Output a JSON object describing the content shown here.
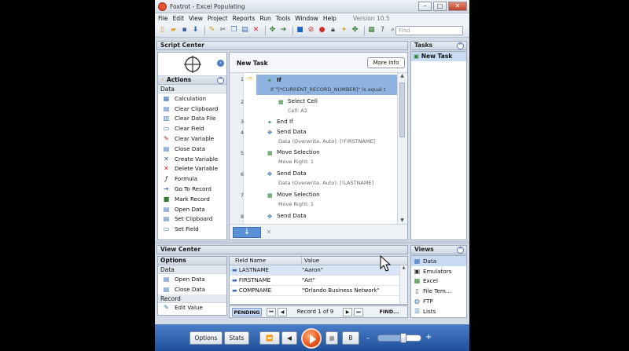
{
  "window": {
    "title": "Foxtrot - Excel Populating"
  },
  "menu": {
    "items": [
      "File",
      "Edit",
      "View",
      "Project",
      "Reports",
      "Run",
      "Tools",
      "Window",
      "Help"
    ],
    "version": "Version 10.5"
  },
  "search": {
    "placeholder": "Find"
  },
  "script_center": {
    "header": "Script Center",
    "actions_header": "Actions",
    "category_data": "Data",
    "actions": [
      "Calculation",
      "Clear Clipboard",
      "Clear Data File",
      "Clear Field",
      "Clear Variable",
      "Close Data",
      "Create Variable",
      "Delete Variable",
      "Formula",
      "Go To Record",
      "Mark Record",
      "Open Data",
      "Set Clipboard",
      "Set Field"
    ],
    "task_title": "New Task",
    "more_info": "More Info",
    "steps": [
      {
        "num": "1",
        "title": "If",
        "sub": "If \"[*CURRENT_RECORD_NUMBER]\" is equal t"
      },
      {
        "num": "2",
        "title": "Select Cell",
        "sub": "Cell:  A2"
      },
      {
        "num": "3",
        "title": "End If",
        "sub": ""
      },
      {
        "num": "4",
        "title": "Send Data",
        "sub": "Data (Overwrite, Auto):  [!FIRSTNAME]"
      },
      {
        "num": "5",
        "title": "Move Selection",
        "sub": "Move Right:  1"
      },
      {
        "num": "6",
        "title": "Send Data",
        "sub": "Data (Overwrite, Auto):  [!LASTNAME]"
      },
      {
        "num": "7",
        "title": "Move Selection",
        "sub": "Move Right:  1"
      },
      {
        "num": "8",
        "title": "Send Data",
        "sub": ""
      }
    ]
  },
  "tasks": {
    "header": "Tasks",
    "items": [
      "New Task"
    ]
  },
  "view_center": {
    "header": "View Center",
    "options_header": "Options",
    "category_data": "Data",
    "data_items": [
      "Open Data",
      "Close Data"
    ],
    "category_record": "Record",
    "record_items": [
      "Edit Value"
    ],
    "columns": [
      "Field Name",
      "Value"
    ],
    "rows": [
      {
        "field": "LASTNAME",
        "value": "\"Aaron\""
      },
      {
        "field": "FIRSTNAME",
        "value": "\"Art\""
      },
      {
        "field": "COMPNAME",
        "value": "\"Orlando Business Network\""
      }
    ],
    "pending": "PENDING",
    "record_label": "Record 1 of 9",
    "find": "FIND..."
  },
  "views": {
    "header": "Views",
    "items": [
      "Data",
      "Emulators",
      "Excel",
      "File Tem...",
      "FTP",
      "Lists"
    ]
  },
  "bottom": {
    "options": "Options",
    "stats": "Stats",
    "b": "B",
    "speed": 0.6
  }
}
